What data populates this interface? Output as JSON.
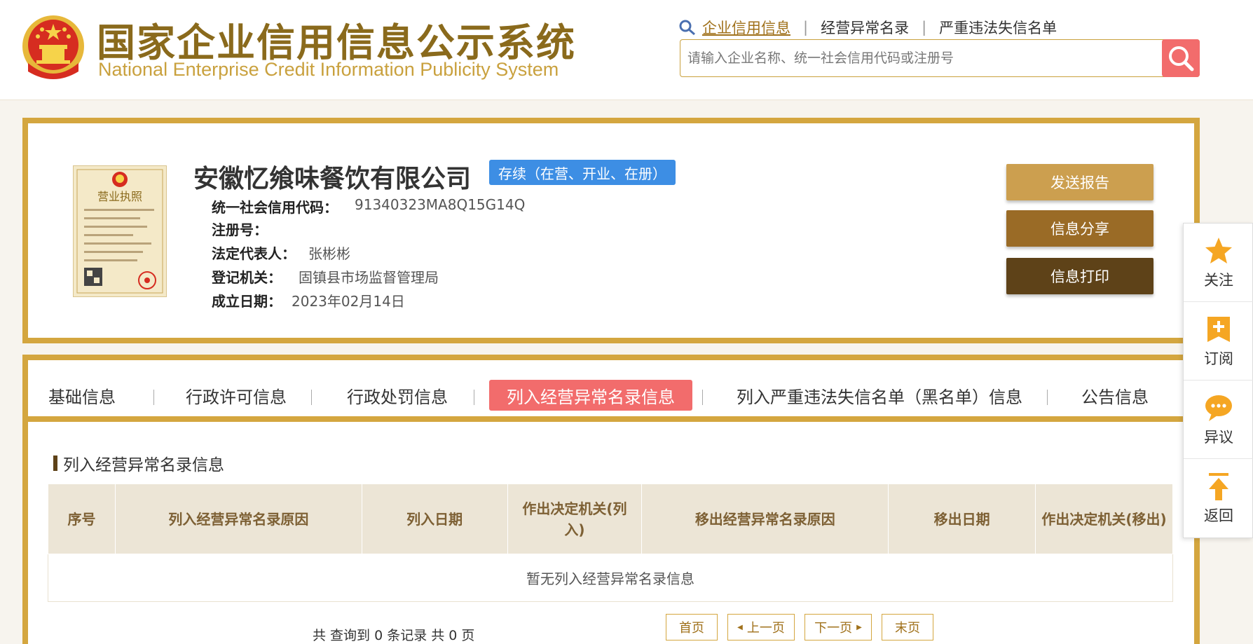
{
  "header": {
    "title_zh": "国家企业信用信息公示系统",
    "title_en": "National Enterprise Credit Information Publicity System",
    "nav": [
      {
        "label": "企业信用信息",
        "active": true
      },
      {
        "label": "经营异常名录",
        "active": false
      },
      {
        "label": "严重违法失信名单",
        "active": false
      }
    ],
    "search_placeholder": "请输入企业名称、统一社会信用代码或注册号"
  },
  "company": {
    "name": "安徽忆飨味餐饮有限公司",
    "status": "存续（在营、开业、在册）",
    "fields": [
      {
        "label": "统一社会信用代码：",
        "value": "91340323MA8Q15G14Q"
      },
      {
        "label": "注册号：",
        "value": ""
      },
      {
        "label": "法定代表人：",
        "value": "张彬彬"
      },
      {
        "label": "登记机关：",
        "value": "固镇县市场监督管理局"
      },
      {
        "label": "成立日期：",
        "value": "2023年02月14日"
      }
    ],
    "license_text": "营业执照",
    "buttons": {
      "report": "发送报告",
      "share": "信息分享",
      "print": "信息打印"
    }
  },
  "tabs": [
    {
      "label": "基础信息",
      "active": false
    },
    {
      "label": "行政许可信息",
      "active": false
    },
    {
      "label": "行政处罚信息",
      "active": false
    },
    {
      "label": "列入经营异常名录信息",
      "active": true
    },
    {
      "label": "列入严重违法失信名单（黑名单）信息",
      "active": false
    },
    {
      "label": "公告信息",
      "active": false
    }
  ],
  "section": {
    "title": "列入经营异常名录信息",
    "columns": [
      "序号",
      "列入经营异常名录原因",
      "列入日期",
      "作出决定机关(列入)",
      "移出经营异常名录原因",
      "移出日期",
      "作出决定机关(移出)"
    ],
    "empty_message": "暂无列入经营异常名录信息"
  },
  "pager": {
    "summary": "共 查询到 0 条记录 共 0 页",
    "first": "首页",
    "prev": "上一页",
    "next": "下一页",
    "last": "末页"
  },
  "side_toolbar": [
    {
      "label": "关注",
      "icon": "star-icon"
    },
    {
      "label": "订阅",
      "icon": "subscribe-plus-icon"
    },
    {
      "label": "异议",
      "icon": "chat-bubble-icon"
    },
    {
      "label": "返回",
      "icon": "back-to-top-icon"
    }
  ],
  "colors": {
    "brand_gold": "#d4a63f",
    "brand_brown": "#8a6a1c",
    "accent_red": "#f26c6c",
    "status_blue": "#3d8ee4"
  }
}
